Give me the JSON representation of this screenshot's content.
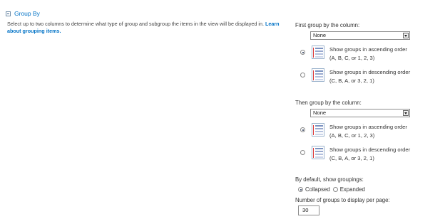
{
  "section": {
    "title": "Group By",
    "description": "Select up to two columns to determine what type of group and subgroup the items in the view will be displayed in.",
    "learn_link": "Learn about grouping items."
  },
  "first_group": {
    "label": "First group by the column:",
    "selected": "None",
    "ascending": {
      "line1": "Show groups in ascending order",
      "line2": "(A, B, C, or 1, 2, 3)",
      "checked": true
    },
    "descending": {
      "line1": "Show groups in descending order",
      "line2": "(C, B, A, or 3, 2, 1)",
      "checked": false
    }
  },
  "then_group": {
    "label": "Then group by the column:",
    "selected": "None",
    "ascending": {
      "line1": "Show groups in ascending order",
      "line2": "(A, B, C, or 1, 2, 3)",
      "checked": true
    },
    "descending": {
      "line1": "Show groups in descending order",
      "line2": "(C, B, A, or 3, 2, 1)",
      "checked": false
    }
  },
  "default_groupings": {
    "label": "By default, show groupings:",
    "collapsed": "Collapsed",
    "expanded": "Expanded",
    "selected": "Collapsed"
  },
  "groups_per_page": {
    "label": "Number of groups to display per page:",
    "value": "30"
  },
  "colors": {
    "link": "#0072c6",
    "text": "#444444"
  }
}
